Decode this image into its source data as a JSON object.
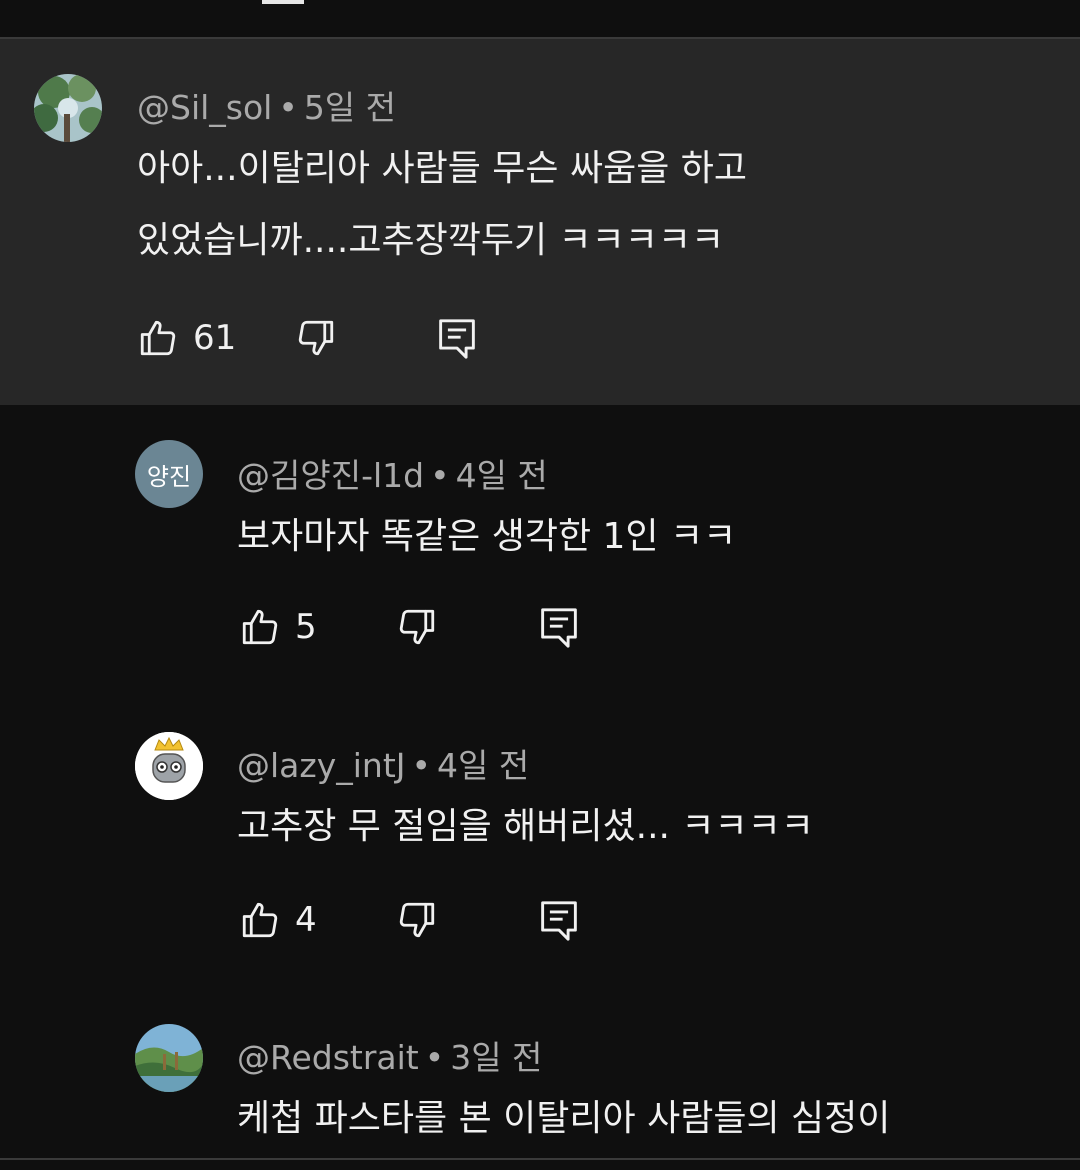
{
  "comments": [
    {
      "handle": "@Sil_sol",
      "time": "5일 전",
      "lines": [
        "아아...이탈리아 사람들 무슨 싸움을 하고",
        "있었습니까....고추장깍두기 ㅋㅋㅋㅋㅋ"
      ],
      "likes": "61",
      "avatar_icon": "nature-photo-icon"
    },
    {
      "handle": "@김양진-l1d",
      "time": "4일 전",
      "lines": [
        "보자마자 똑같은 생각한 1인 ㅋㅋ"
      ],
      "likes": "5",
      "avatar_text": "양진"
    },
    {
      "handle": "@lazy_intJ",
      "time": "4일 전",
      "lines": [
        "고추장 무 절임을 해버리셨... ㅋㅋㅋㅋ"
      ],
      "likes": "4",
      "avatar_icon": "crowned-robot-icon"
    },
    {
      "handle": "@Redstrait",
      "time": "3일 전",
      "lines": [
        "케첩 파스타를 본 이탈리아 사람들의 심정이"
      ],
      "avatar_icon": "landscape-photo-icon"
    }
  ],
  "separator": "•",
  "colors": {
    "background": "#0f0f0f",
    "highlight": "#272727",
    "meta": "#aaaaaa",
    "text": "#f1f1f1"
  }
}
